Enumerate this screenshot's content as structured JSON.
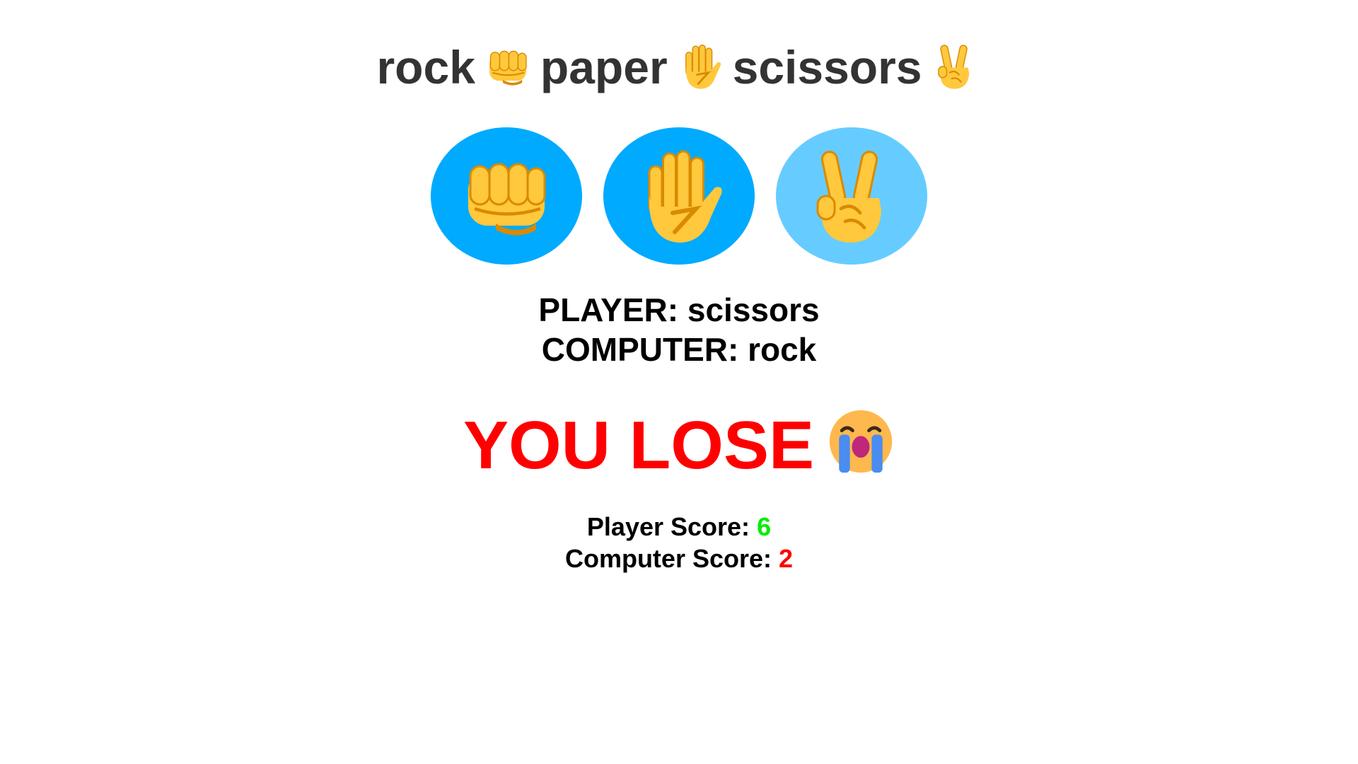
{
  "title": {
    "word_rock": "rock",
    "word_paper": "paper",
    "word_scissors": "scissors",
    "icons": [
      "fist-icon",
      "raised-hand-icon",
      "victory-hand-icon"
    ]
  },
  "choices": [
    {
      "name": "rock",
      "icon": "fist-icon",
      "selected": false
    },
    {
      "name": "paper",
      "icon": "raised-hand-icon",
      "selected": false
    },
    {
      "name": "scissors",
      "icon": "victory-hand-icon",
      "selected": true
    }
  ],
  "result": {
    "player_label": "PLAYER:",
    "player_choice": "scissors",
    "computer_label": "COMPUTER:",
    "computer_choice": "rock"
  },
  "verdict": {
    "text": "YOU LOSE",
    "icon": "crying-face-icon",
    "color": "#ff0000"
  },
  "scores": {
    "player_label": "Player Score:",
    "player_value": "6",
    "player_color": "#00ee00",
    "computer_label": "Computer Score:",
    "computer_value": "2",
    "computer_color": "#ff0000"
  },
  "colors": {
    "button_bg": "#00aaff",
    "button_selected_bg": "#66ccff",
    "title_text": "#333333",
    "emoji_yellow": "#ffc83d",
    "emoji_shadow": "#d98a00"
  }
}
